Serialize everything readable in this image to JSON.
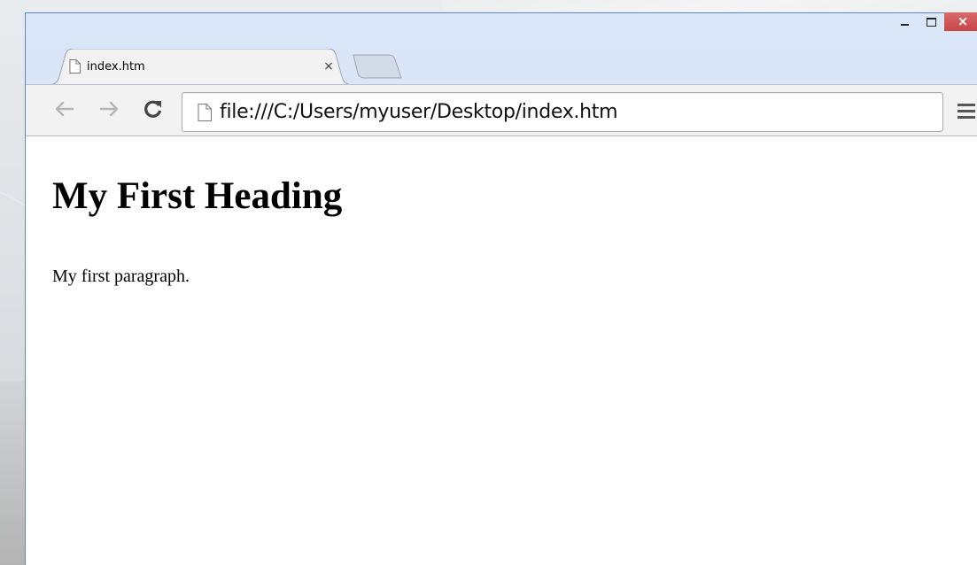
{
  "tab": {
    "title": "index.htm",
    "close_glyph": "×",
    "favicon": "document-icon"
  },
  "toolbar": {
    "back_icon": "back-arrow-icon",
    "forward_icon": "forward-arrow-icon",
    "reload_icon": "reload-icon",
    "menu_icon": "hamburger-menu-icon"
  },
  "omnibox": {
    "url": "file:///C:/Users/myuser/Desktop/index.htm",
    "page_icon": "document-icon"
  },
  "window_controls": {
    "close_glyph": "×"
  },
  "page": {
    "heading": "My First Heading",
    "paragraph": "My first paragraph."
  },
  "colors": {
    "close_button": "#c74646",
    "frame": "#cfdff4",
    "toolbar": "#f2f2f2"
  }
}
